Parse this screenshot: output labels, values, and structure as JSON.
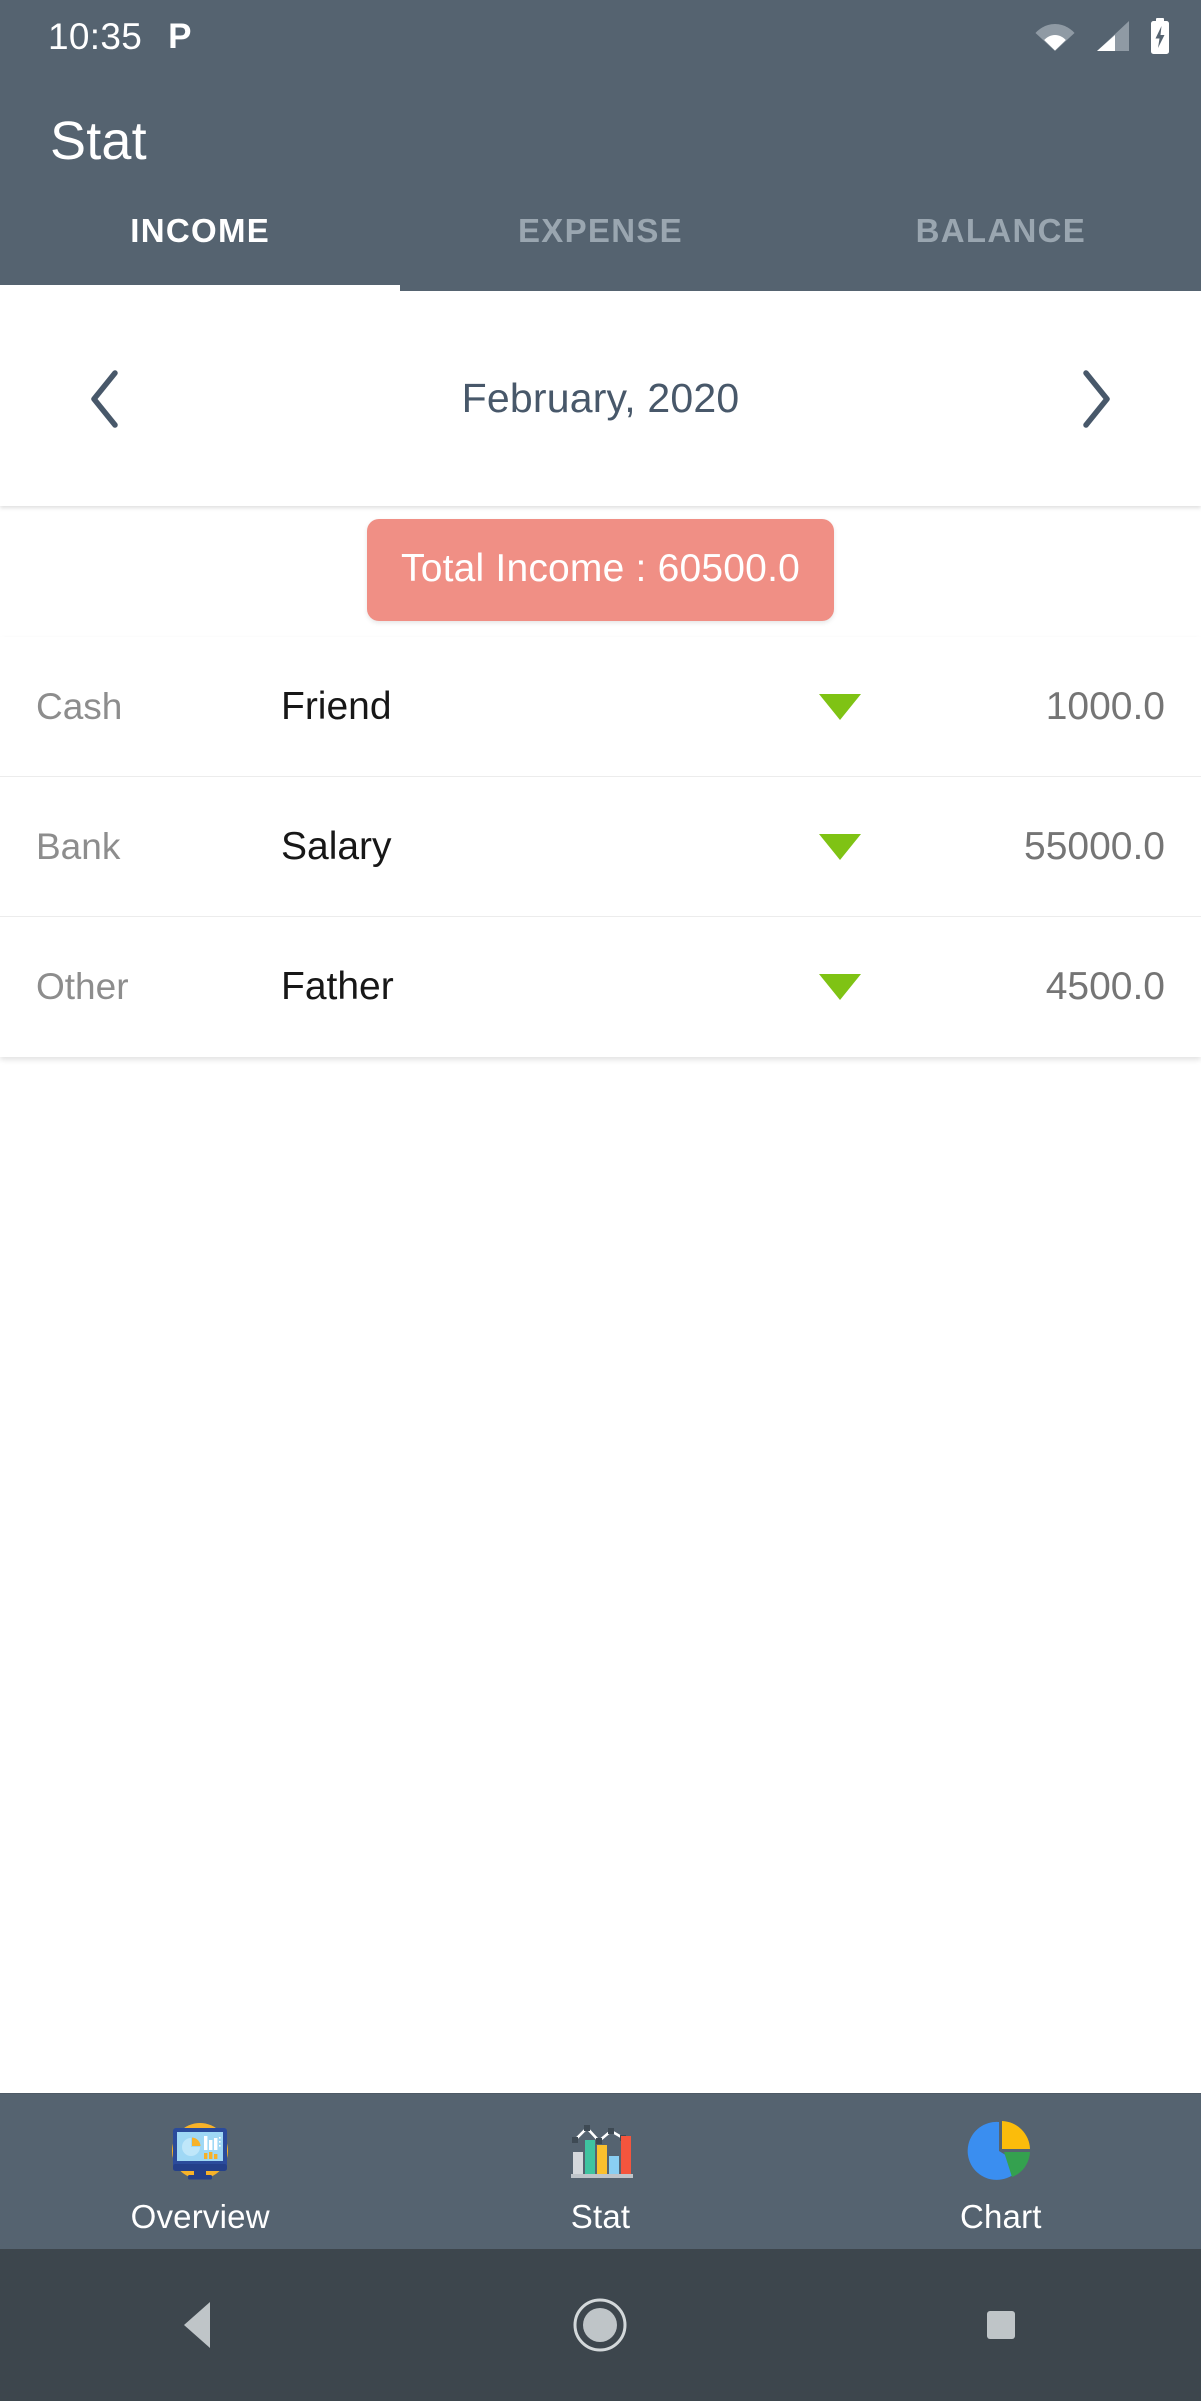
{
  "status_bar": {
    "time": "10:35",
    "notification_icon": "p-notification-icon",
    "notification_glyph": "P",
    "wifi_icon": "wifi-icon",
    "signal_icon": "cellular-signal-icon",
    "battery_icon": "battery-charging-icon"
  },
  "app_bar": {
    "title": "Stat"
  },
  "tabs": [
    {
      "label": "INCOME",
      "active": true
    },
    {
      "label": "EXPENSE",
      "active": false
    },
    {
      "label": "BALANCE",
      "active": false
    }
  ],
  "month_selector": {
    "prev_icon": "chevron-left-icon",
    "next_icon": "chevron-right-icon",
    "label": "February, 2020"
  },
  "total": {
    "label": "Total Income : 60500.0",
    "background_color": "#F08F85",
    "text_color": "#FFFFFF"
  },
  "list": {
    "rows": [
      {
        "account": "Cash",
        "source": "Friend",
        "caret": "triangle-down-icon",
        "amount": "1000.0"
      },
      {
        "account": "Bank",
        "source": "Salary",
        "caret": "triangle-down-icon",
        "amount": "55000.0"
      },
      {
        "account": "Other",
        "source": "Father",
        "caret": "triangle-down-icon",
        "amount": "4500.0"
      }
    ],
    "caret_color": "#7FC314"
  },
  "bottom_nav": [
    {
      "label": "Overview",
      "icon": "dashboard-monitor-icon"
    },
    {
      "label": "Stat",
      "icon": "bar-chart-icon"
    },
    {
      "label": "Chart",
      "icon": "pie-chart-icon"
    }
  ],
  "android_nav": {
    "back": "back-triangle-icon",
    "home": "home-circle-icon",
    "recents": "recents-square-icon"
  },
  "theme": {
    "header_background": "#556370",
    "navbar_background": "#3D464D",
    "accent_green": "#7FC314",
    "accent_coral": "#F08F85",
    "content_background": "#FFFFFF"
  }
}
